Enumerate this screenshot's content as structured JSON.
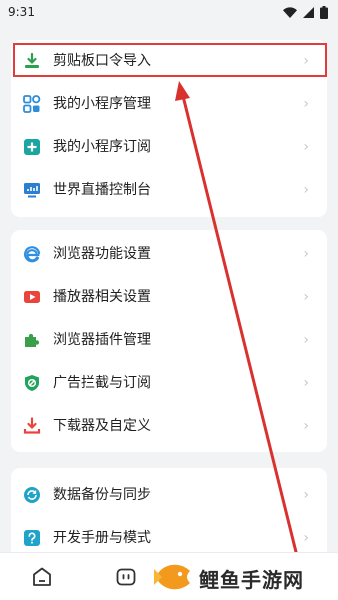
{
  "status_bar": {
    "time": "9:31"
  },
  "groups": [
    {
      "items": [
        {
          "label": "剪贴板口令导入",
          "icon": "download-tray-icon"
        },
        {
          "label": "我的小程序管理",
          "icon": "grid-apps-icon"
        },
        {
          "label": "我的小程序订阅",
          "icon": "subscribe-plus-icon"
        },
        {
          "label": "世界直播控制台",
          "icon": "monitor-chart-icon"
        }
      ]
    },
    {
      "items": [
        {
          "label": "浏览器功能设置",
          "icon": "browser-e-icon"
        },
        {
          "label": "播放器相关设置",
          "icon": "play-icon"
        },
        {
          "label": "浏览器插件管理",
          "icon": "puzzle-icon"
        },
        {
          "label": "广告拦截与订阅",
          "icon": "shield-block-icon"
        },
        {
          "label": "下载器及自定义",
          "icon": "download-icon"
        }
      ]
    },
    {
      "items": [
        {
          "label": "数据备份与同步",
          "icon": "cloud-sync-icon"
        },
        {
          "label": "开发手册与模式",
          "icon": "help-question-icon"
        }
      ]
    }
  ],
  "chevron": "›",
  "watermark": {
    "text": "鲤鱼手游网"
  },
  "colors": {
    "accent": "#2ba14b",
    "highlight": "#e23b3b",
    "arrow": "#d9322e"
  }
}
